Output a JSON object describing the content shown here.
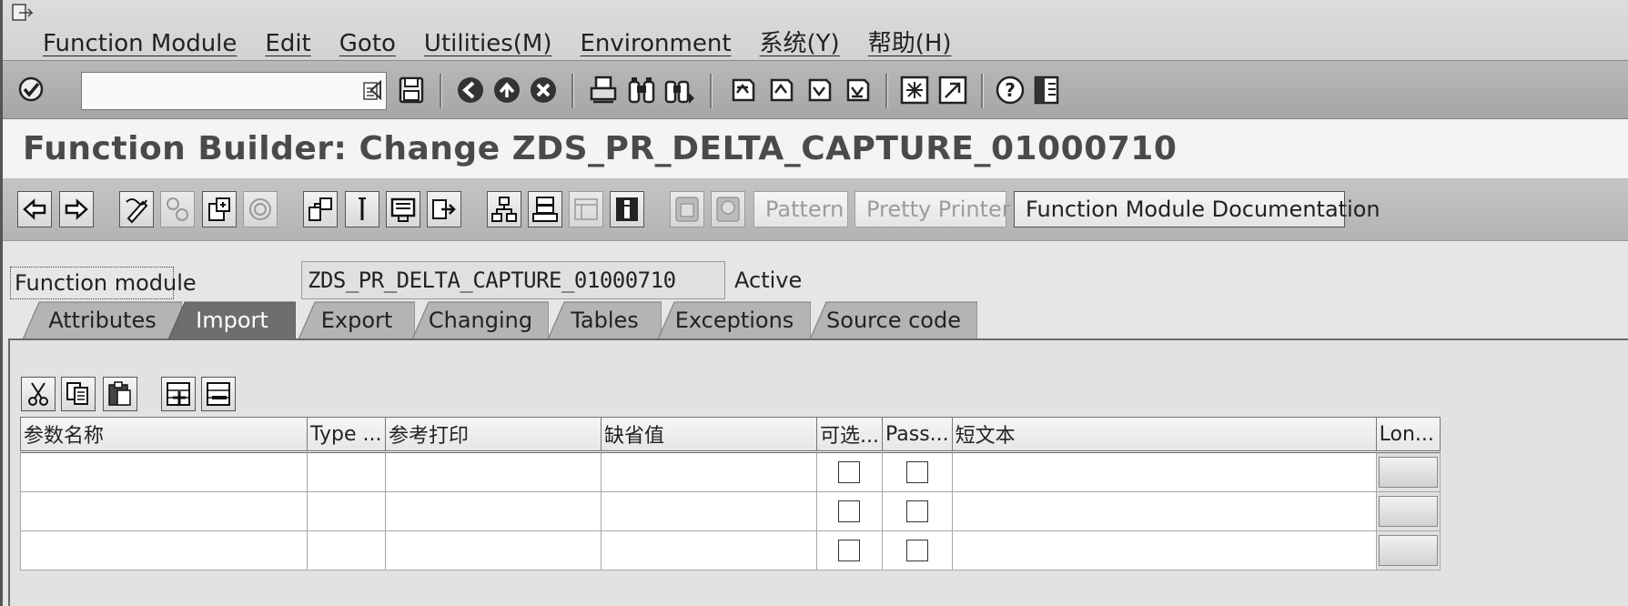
{
  "menu": {
    "items": [
      "Function Module",
      "Edit",
      "Goto",
      "Utilities(M)",
      "Environment",
      "系统(Y)",
      "帮助(H)"
    ]
  },
  "command_field": {
    "value": ""
  },
  "title": "Function Builder: Change ZDS_PR_DELTA_CAPTURE_01000710",
  "app_toolbar": {
    "pattern_label": "Pattern",
    "pretty_printer_label": "Pretty Printer",
    "fm_doc_label": "Function Module Documentation"
  },
  "function_module": {
    "label": "Function module",
    "value": "ZDS_PR_DELTA_CAPTURE_01000710",
    "status": "Active"
  },
  "tabs": [
    {
      "label": "Attributes",
      "active": false
    },
    {
      "label": "Import",
      "active": true
    },
    {
      "label": "Export",
      "active": false
    },
    {
      "label": "Changing",
      "active": false
    },
    {
      "label": "Tables",
      "active": false
    },
    {
      "label": "Exceptions",
      "active": false
    },
    {
      "label": "Source code",
      "active": false
    }
  ],
  "param_table": {
    "columns": [
      "参数名称",
      "Type ...",
      "参考打印",
      "缺省值",
      "可选...",
      "Pass...",
      "短文本",
      "Lon..."
    ],
    "rows": [
      {
        "name": "",
        "type": "",
        "ref": "",
        "default": "",
        "optional": false,
        "pass_value": false,
        "short_text": ""
      },
      {
        "name": "",
        "type": "",
        "ref": "",
        "default": "",
        "optional": false,
        "pass_value": false,
        "short_text": ""
      },
      {
        "name": "",
        "type": "",
        "ref": "",
        "default": "",
        "optional": false,
        "pass_value": false,
        "short_text": ""
      }
    ]
  },
  "icons": {
    "standard_toolbar": [
      "enter-icon",
      "dropdown-icon",
      "back-arrow-icon",
      "save-icon",
      "back-icon",
      "exit-icon",
      "cancel-icon",
      "print-icon",
      "find-icon",
      "find-next-icon",
      "first-page-icon",
      "previous-page-icon",
      "next-page-icon",
      "last-page-icon",
      "new-session-icon",
      "shortcut-icon",
      "help-icon",
      "layout-menu-icon"
    ],
    "app_toolbar": [
      "back-icon",
      "forward-icon",
      "display-change-icon",
      "active-inactive-icon",
      "other-object-icon",
      "activate-icon",
      "where-used-icon",
      "insert-icon",
      "display-object-list-icon",
      "navigation-icon",
      "hierarchy-icon",
      "stack-icon",
      "window-icon",
      "info-icon",
      "copy-disabled-icon",
      "test-disabled-icon"
    ],
    "grid_toolbar": [
      "cut-icon",
      "copy-icon",
      "paste-icon",
      "insert-row-icon",
      "delete-row-icon"
    ]
  }
}
